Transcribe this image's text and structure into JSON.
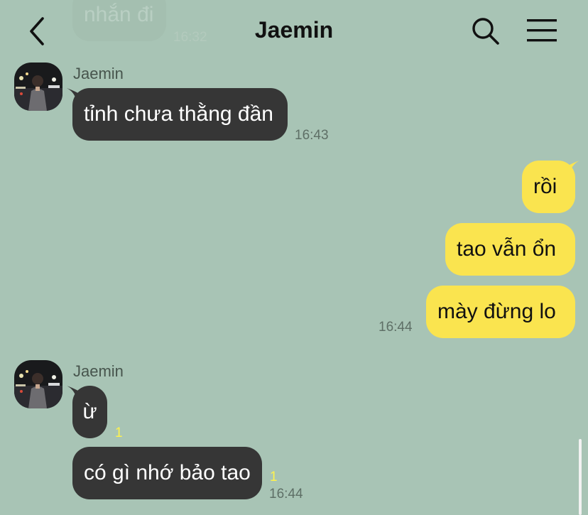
{
  "header": {
    "title": "Jaemin",
    "back_icon": "chevron-left-icon",
    "search_icon": "search-icon",
    "menu_icon": "hamburger-menu-icon"
  },
  "colors": {
    "background": "#a8c4b5",
    "incoming_bubble": "#363636",
    "outgoing_bubble": "#fae44f",
    "unread_count": "#fff24d"
  },
  "messages": {
    "prev_cut": {
      "text": "nhắn đi",
      "time": "16:32"
    },
    "group1": {
      "sender": "Jaemin",
      "m1": {
        "text": "tỉnh chưa thằng đần",
        "time": "16:43"
      }
    },
    "group2": {
      "m1": {
        "text": "rồi"
      },
      "m2": {
        "text": "tao vẫn ổn"
      },
      "m3": {
        "text": "mày đừng lo",
        "time": "16:44"
      }
    },
    "group3": {
      "sender": "Jaemin",
      "m1": {
        "text": "ừ",
        "unread": "1"
      },
      "m2": {
        "text": "có gì nhớ bảo tao",
        "unread": "1",
        "time": "16:44"
      }
    }
  }
}
